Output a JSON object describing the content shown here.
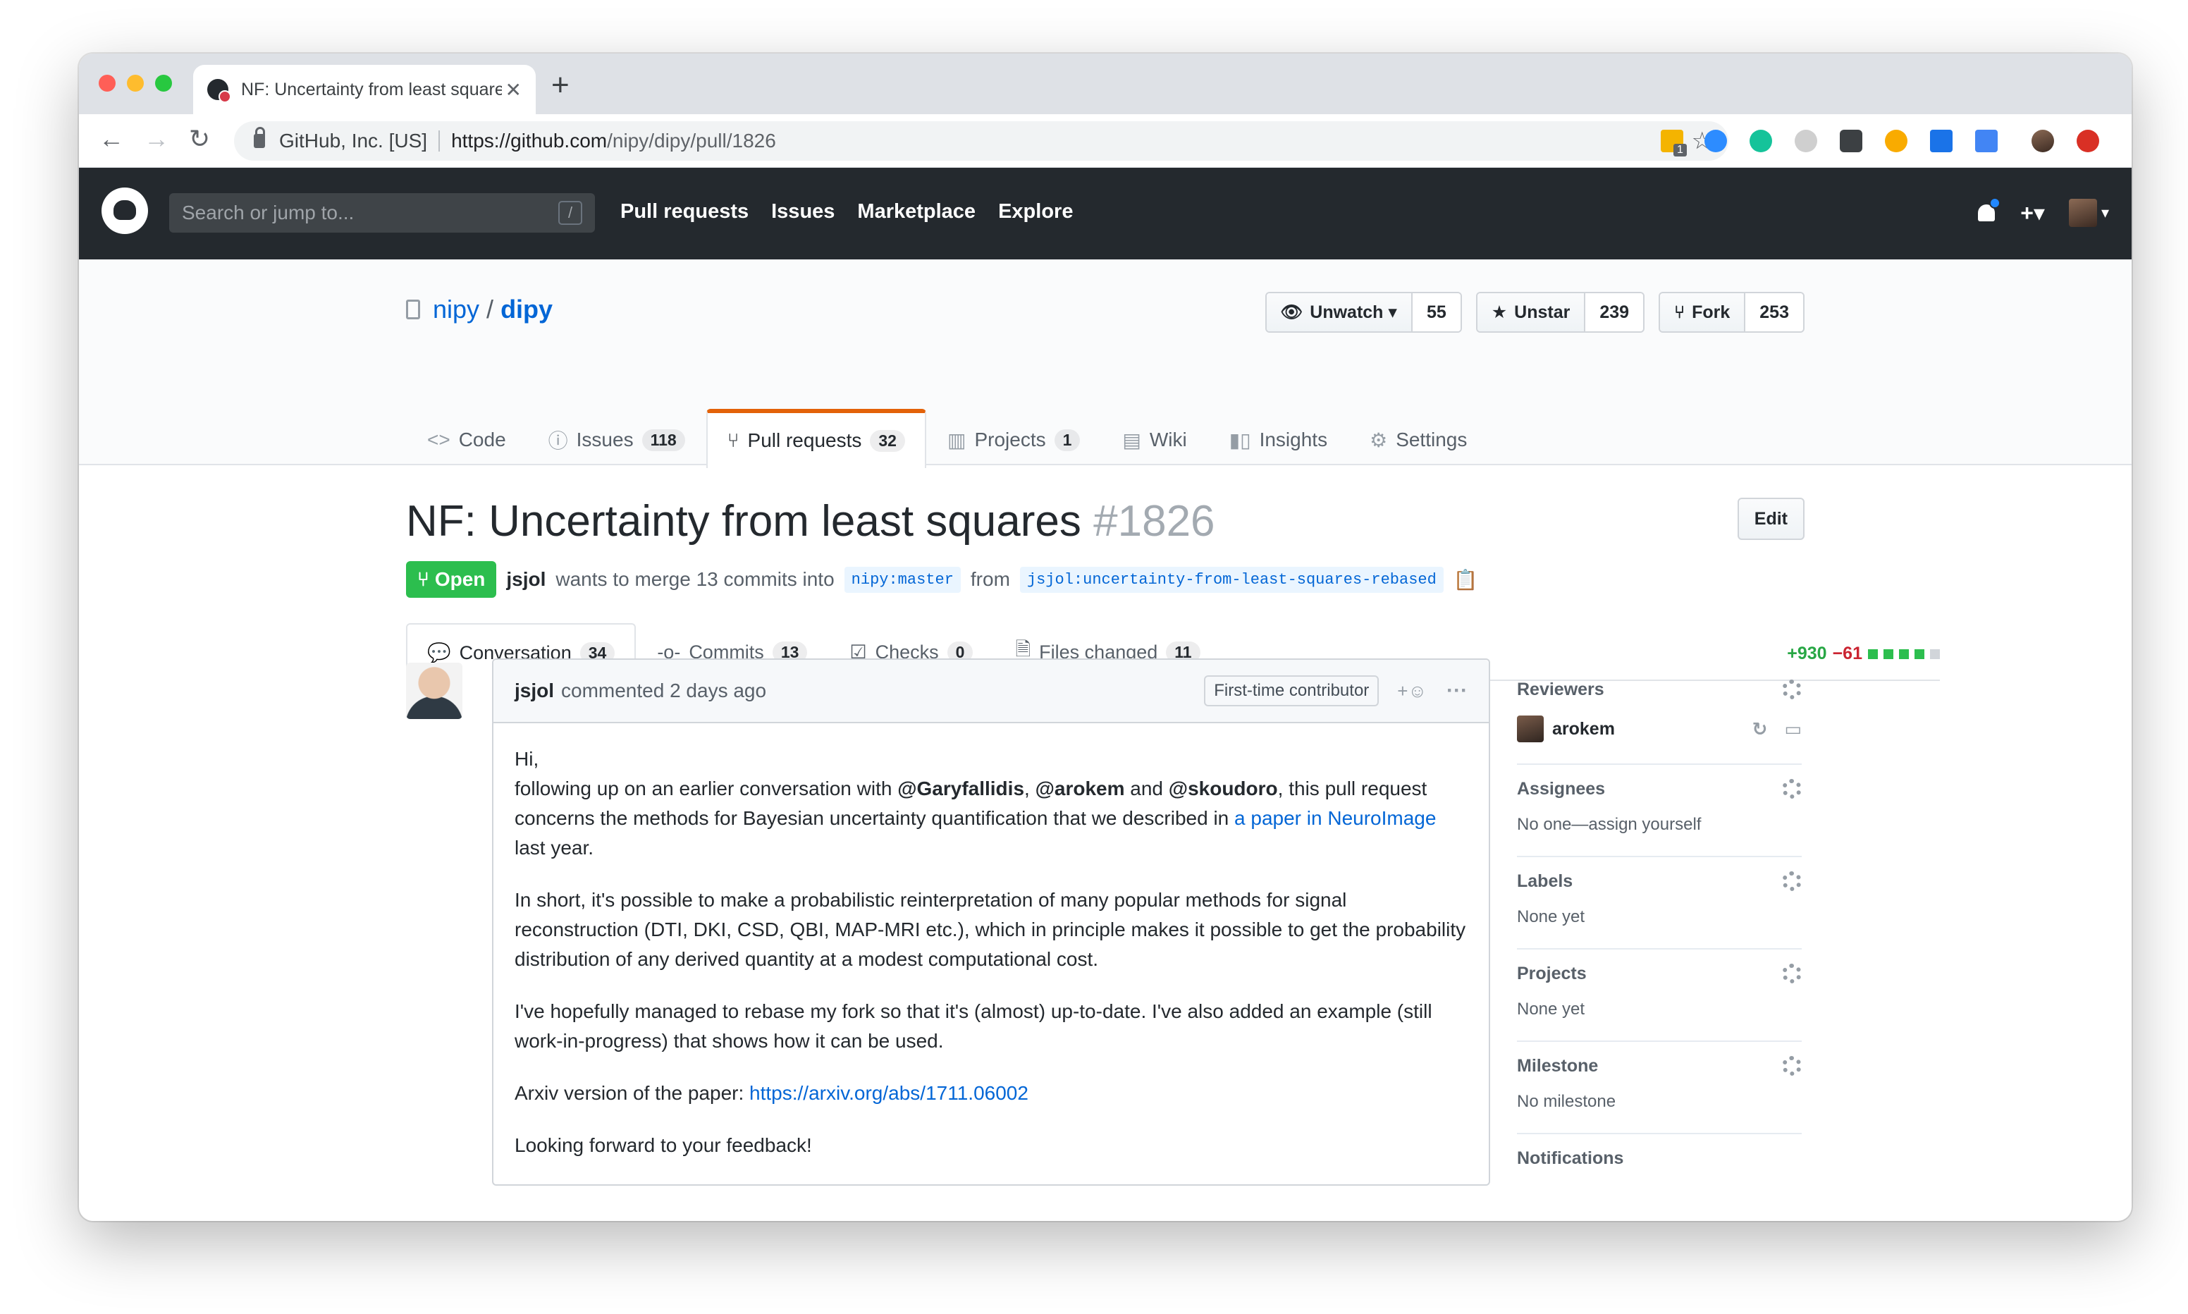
{
  "browser": {
    "tab_title": "NF: Uncertainty from least squares",
    "url_org": "GitHub, Inc. [US]",
    "url_domain": "https://github.com",
    "url_path": "/nipy/dipy/pull/1826",
    "ext_badge": "1",
    "traffic_lights": [
      "#ff5f57",
      "#febc2e",
      "#28c840"
    ]
  },
  "header": {
    "search_placeholder": "Search or jump to...",
    "search_shortcut": "/",
    "nav": [
      "Pull requests",
      "Issues",
      "Marketplace",
      "Explore"
    ],
    "plus": "+▾"
  },
  "repo": {
    "owner": "nipy",
    "separator": "/",
    "name": "dipy",
    "watch_label": "Unwatch ▾",
    "watch_count": "55",
    "star_label": "Unstar",
    "star_count": "239",
    "fork_label": "Fork",
    "fork_count": "253",
    "tabs": [
      {
        "label": "Code",
        "count": ""
      },
      {
        "label": "Issues",
        "count": "118"
      },
      {
        "label": "Pull requests",
        "count": "32"
      },
      {
        "label": "Projects",
        "count": "1"
      },
      {
        "label": "Wiki",
        "count": ""
      },
      {
        "label": "Insights",
        "count": ""
      },
      {
        "label": "Settings",
        "count": ""
      }
    ]
  },
  "pr": {
    "title": "NF: Uncertainty from least squares",
    "number": "#1826",
    "edit": "Edit",
    "state": "Open",
    "author": "jsjol",
    "merge_text": "wants to merge 13 commits into",
    "base": "nipy:master",
    "from": "from",
    "head": "jsjol:uncertainty-from-least-squares-rebased",
    "tabs": [
      {
        "label": "Conversation",
        "count": "34"
      },
      {
        "label": "Commits",
        "count": "13"
      },
      {
        "label": "Checks",
        "count": "0"
      },
      {
        "label": "Files changed",
        "count": "11"
      }
    ],
    "additions": "+930",
    "deletions": "−61"
  },
  "comment": {
    "author": "jsjol",
    "when": "commented 2 days ago",
    "badge": "First-time contributor",
    "reaction": "+☺",
    "more": "···",
    "p1_hi": "Hi,",
    "p1_a": "following up on an earlier conversation with ",
    "m1": "@Garyfallidis",
    "c1": ", ",
    "m2": "@arokem",
    "c2": " and ",
    "m3": "@skoudoro",
    "p1_b": ", this pull request concerns the methods for Bayesian uncertainty quantification that we described in ",
    "link1": "a paper in NeuroImage",
    "p1_c": " last year.",
    "p2": "In short, it's possible to make a probabilistic reinterpretation of many popular methods for signal reconstruction (DTI, DKI, CSD, QBI, MAP-MRI etc.), which in principle makes it possible to get the probability distribution of any derived quantity at a modest computational cost.",
    "p3": "I've hopefully managed to rebase my fork so that it's (almost) up-to-date. I've also added an example (still work-in-progress) that shows how it can be used.",
    "p4_a": "Arxiv version of the paper: ",
    "p4_link": "https://arxiv.org/abs/1711.06002",
    "p5": "Looking forward to your feedback!"
  },
  "sidebar": {
    "reviewers_title": "Reviewers",
    "reviewer": "arokem",
    "assignees_title": "Assignees",
    "assignees_value": "No one—assign yourself",
    "labels_title": "Labels",
    "labels_value": "None yet",
    "projects_title": "Projects",
    "projects_value": "None yet",
    "milestone_title": "Milestone",
    "milestone_value": "No milestone",
    "notifications_title": "Notifications"
  }
}
